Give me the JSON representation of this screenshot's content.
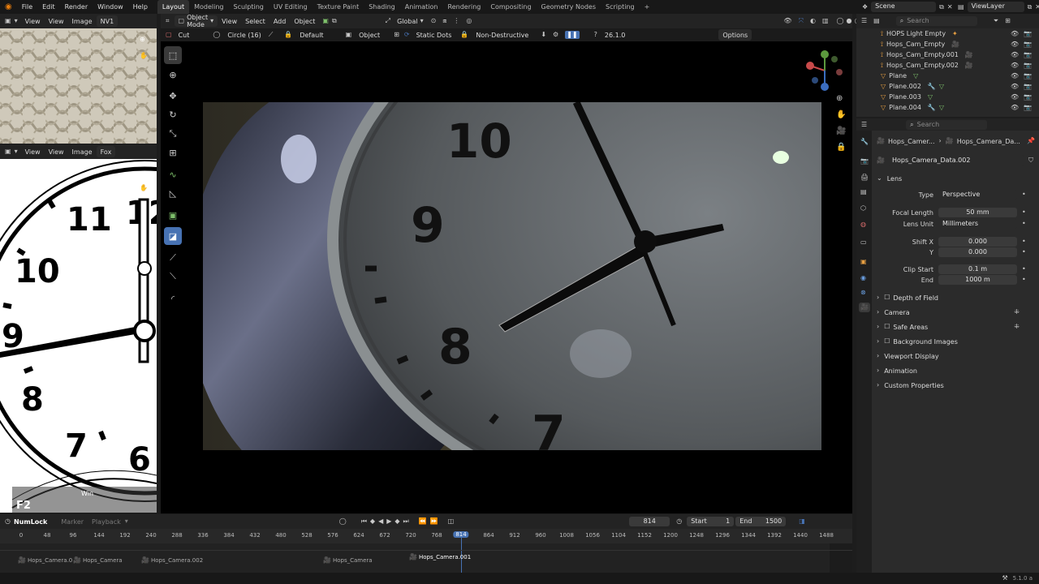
{
  "topbar": {
    "menus": [
      "File",
      "Edit",
      "Render",
      "Window",
      "Help"
    ],
    "workspaces": [
      "Layout",
      "Modeling",
      "Sculpting",
      "UV Editing",
      "Texture Paint",
      "Shading",
      "Animation",
      "Rendering",
      "Compositing",
      "Geometry Nodes",
      "Scripting"
    ],
    "active_workspace": "Layout",
    "add_tab": "+",
    "scene": "Scene",
    "view_layer": "ViewLayer"
  },
  "left_top_editor": {
    "view": "View",
    "view2": "View",
    "image": "Image",
    "tag": "NV1"
  },
  "left_bottom_editor": {
    "view": "View",
    "view2": "View",
    "image": "Image",
    "tag": "Fox",
    "overlay_key": "F2",
    "overlay_mod": "Win"
  },
  "viewport_header": {
    "mode": "Object Mode",
    "view": "View",
    "select": "Select",
    "add": "Add",
    "object": "Object",
    "orientation": "Global"
  },
  "tool_header": {
    "cut": "Cut",
    "circle": "Circle (16)",
    "default": "Default",
    "object": "Object",
    "static_dots": "Static Dots",
    "non_destructive": "Non-Destructive",
    "version": "26.1.0",
    "options": "Options"
  },
  "outliner": {
    "search_placeholder": "Search",
    "items": [
      "HOPS Light Empty",
      "Hops_Cam_Empty",
      "Hops_Cam_Empty.001",
      "Hops_Cam_Empty.002",
      "Plane",
      "Plane.002",
      "Plane.003",
      "Plane.004"
    ]
  },
  "properties": {
    "search_placeholder": "Search",
    "breadcrumb_a": "Hops_Camer...",
    "breadcrumb_b": "Hops_Camera_Da...",
    "datablock": "Hops_Camera_Data.002",
    "lens_panel": "Lens",
    "type_label": "Type",
    "type_value": "Perspective",
    "focal_label": "Focal Length",
    "focal_value": "50 mm",
    "unit_label": "Lens Unit",
    "unit_value": "Millimeters",
    "shiftx_label": "Shift X",
    "shiftx_value": "0.000",
    "shifty_label": "Y",
    "shifty_value": "0.000",
    "clipstart_label": "Clip Start",
    "clipstart_value": "0.1 m",
    "clipend_label": "End",
    "clipend_value": "1000 m",
    "panels": [
      "Depth of Field",
      "Camera",
      "Safe Areas",
      "Background Images",
      "Viewport Display",
      "Animation",
      "Custom Properties"
    ]
  },
  "timeline": {
    "numlock": "NumLock",
    "marker": "Marker",
    "playback": "Playback",
    "current_frame": "814",
    "start_label": "Start",
    "start_value": "1",
    "end_label": "End",
    "end_value": "1500",
    "ticks": [
      "0",
      "48",
      "96",
      "144",
      "192",
      "240",
      "288",
      "336",
      "384",
      "432",
      "480",
      "528",
      "576",
      "624",
      "672",
      "720",
      "768",
      "814",
      "864",
      "912",
      "960",
      "1008",
      "1056",
      "1104",
      "1152",
      "1200",
      "1248",
      "1296",
      "1344",
      "1392",
      "1440",
      "1488"
    ],
    "markers": [
      "Hops_Camera.0",
      "Hops_Camera",
      "Hops_Camera.002",
      "Hops_Camera",
      "Hops_Camera.001"
    ]
  },
  "status": {
    "version": "5.1.0 a"
  },
  "colors": {
    "accent": "#4772b3",
    "active_frame": "#3f6fb5",
    "outliner_orange": "#e8a042",
    "mesh_green": "#7ec06b"
  }
}
